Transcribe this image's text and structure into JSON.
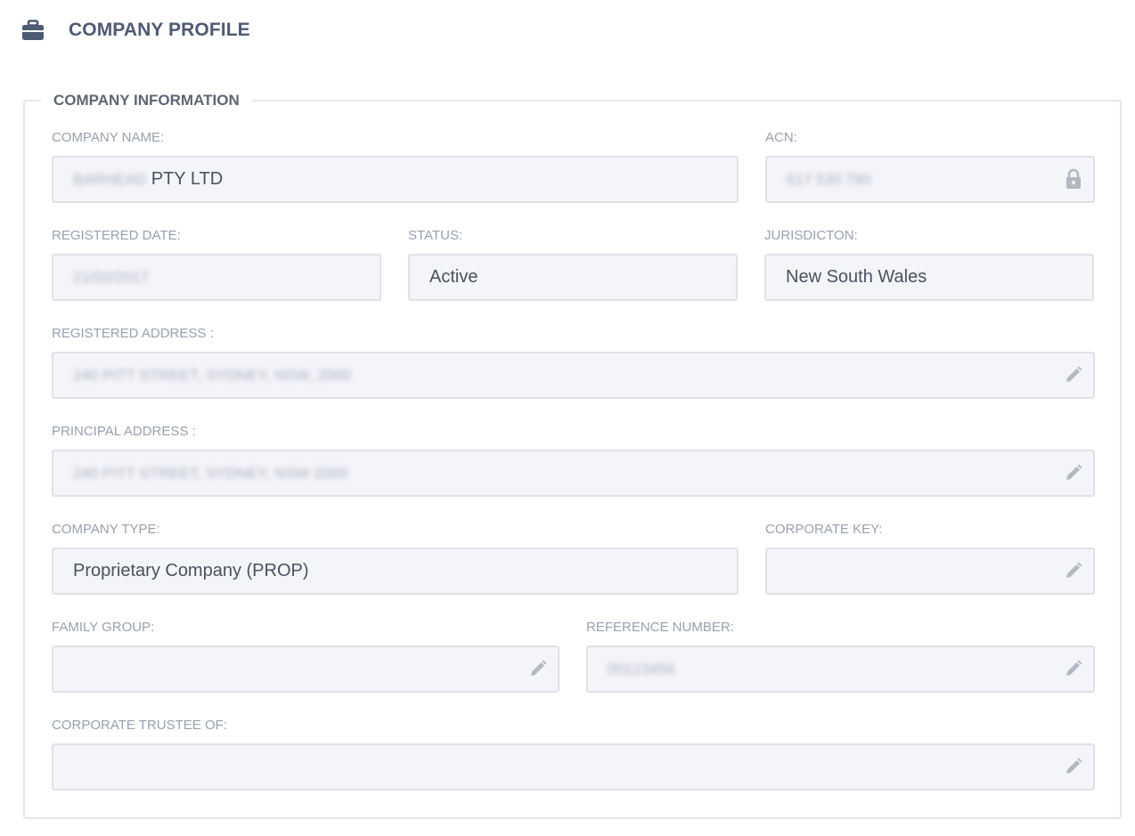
{
  "header": {
    "icon": "briefcase-icon",
    "title": "COMPANY PROFILE"
  },
  "section": {
    "title": "COMPANY INFORMATION"
  },
  "fields": {
    "company_name": {
      "label": "COMPANY NAME:",
      "value_blurred": "BARHEAD",
      "value_suffix": "PTY LTD"
    },
    "acn": {
      "label": "ACN:",
      "value_blurred": "617 530 790",
      "icon": "lock-icon"
    },
    "registered_date": {
      "label": "REGISTERED DATE:",
      "value_blurred": "21/02/2017"
    },
    "status": {
      "label": "STATUS:",
      "value": "Active"
    },
    "jurisdiction": {
      "label": "JURISDICTON:",
      "value": "New South Wales"
    },
    "registered_address": {
      "label": "REGISTERED ADDRESS :",
      "value_blurred": "240 PITT STREET, SYDNEY, NSW, 2000",
      "icon": "pencil-icon"
    },
    "principal_address": {
      "label": "PRINCIPAL ADDRESS :",
      "value_blurred": "240 PITT STREET, SYDNEY, NSW 2000",
      "icon": "pencil-icon"
    },
    "company_type": {
      "label": "COMPANY TYPE:",
      "value": "Proprietary Company (PROP)"
    },
    "corporate_key": {
      "label": "CORPORATE KEY:",
      "value": "",
      "icon": "pencil-icon"
    },
    "family_group": {
      "label": "FAMILY GROUP:",
      "value": "",
      "icon": "pencil-icon"
    },
    "reference_number": {
      "label": "REFERENCE NUMBER:",
      "value_blurred": "00123456",
      "icon": "pencil-icon"
    },
    "corporate_trustee_of": {
      "label": "CORPORATE TRUSTEE OF:",
      "value": "",
      "icon": "pencil-icon"
    }
  },
  "colors": {
    "title": "#4d5b73",
    "label": "#98a0ae",
    "field_bg": "#f4f5f9",
    "field_border": "#dfe2e8",
    "icon": "#b3b8c2"
  }
}
